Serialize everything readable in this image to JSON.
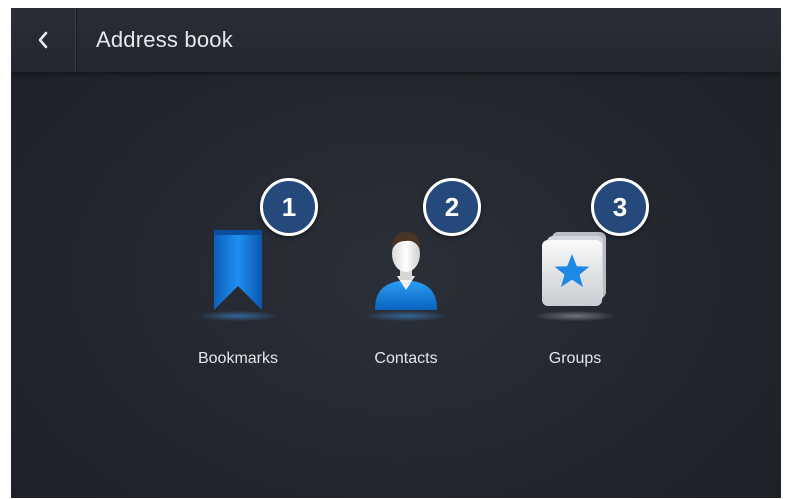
{
  "header": {
    "title": "Address book",
    "back_icon": "chevron-left-icon"
  },
  "items": [
    {
      "label": "Bookmarks",
      "badge": "1",
      "icon": "bookmark-icon"
    },
    {
      "label": "Contacts",
      "badge": "2",
      "icon": "contact-person-icon"
    },
    {
      "label": "Groups",
      "badge": "3",
      "icon": "group-star-icon"
    }
  ],
  "colors": {
    "background": "#23262d",
    "accent_blue": "#1e88e5",
    "badge": "#25497a",
    "text": "#e4e6ea"
  }
}
